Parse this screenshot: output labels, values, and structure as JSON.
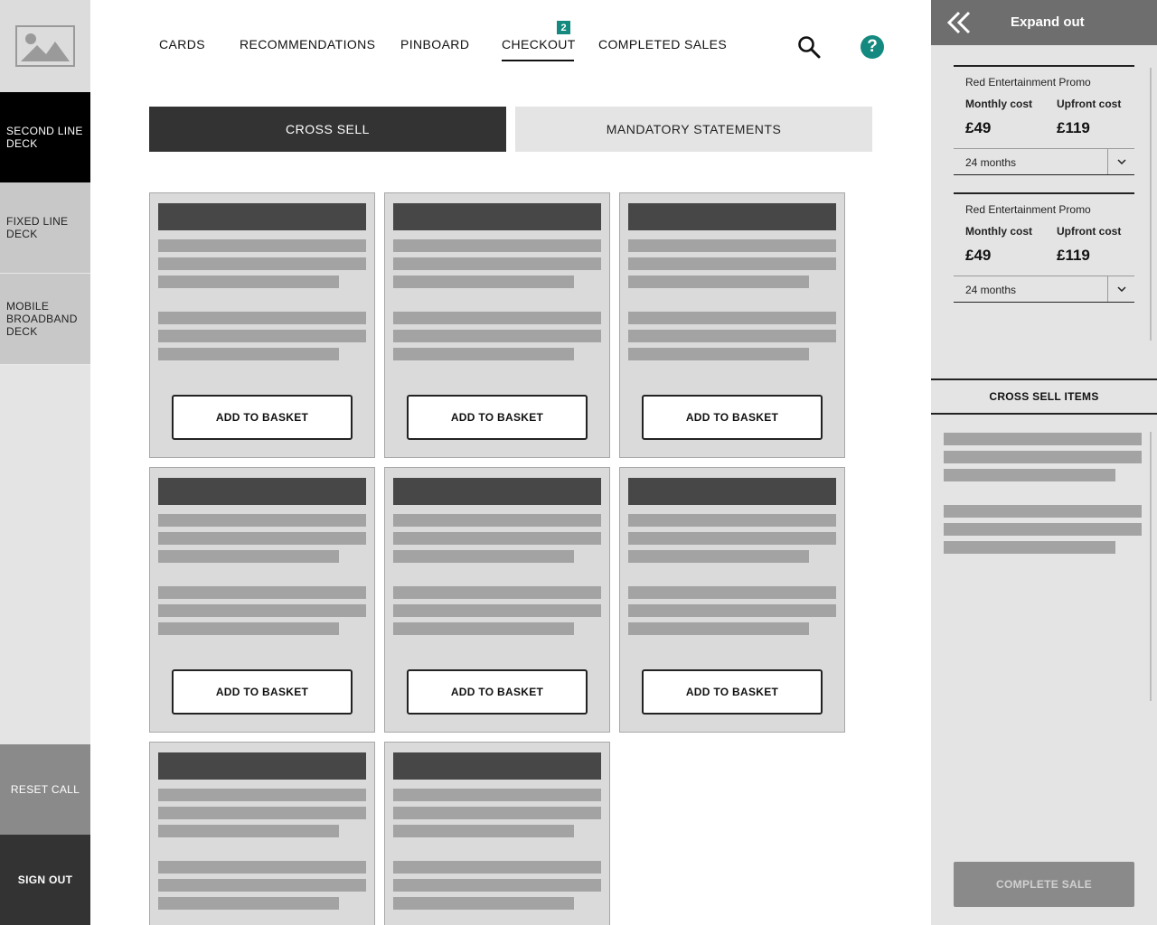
{
  "sidebar": {
    "logo_icon": "image-placeholder-icon",
    "items": [
      {
        "label": "SECOND LINE DECK",
        "active": true
      },
      {
        "label": "FIXED LINE DECK",
        "active": false
      },
      {
        "label": "MOBILE BROADBAND DECK",
        "active": false
      }
    ],
    "reset_label": "RESET CALL",
    "signout_label": "SIGN OUT"
  },
  "nav": {
    "items": [
      {
        "label": "CARDS"
      },
      {
        "label": "RECOMMENDATIONS"
      },
      {
        "label": "PINBOARD"
      },
      {
        "label": "CHECKOUT",
        "active": true,
        "badge": "2"
      },
      {
        "label": "COMPLETED SALES"
      }
    ],
    "search_icon": "search-icon",
    "help_icon": "help-icon",
    "help_glyph": "?",
    "accent_color": "#13897f"
  },
  "tabs": [
    {
      "label": "CROSS SELL",
      "active": true
    },
    {
      "label": "MANDATORY STATEMENTS",
      "active": false
    }
  ],
  "cards": {
    "button_label": "ADD TO BASKET",
    "count": 8
  },
  "right_panel": {
    "expand_label": "Expand out",
    "expand_icon": "double-chevron-left-icon",
    "offers": [
      {
        "name": "Red Entertainment Promo",
        "monthly_label": "Monthly cost",
        "monthly_value": "£49",
        "upfront_label": "Upfront cost",
        "upfront_value": "£119",
        "term": "24 months"
      },
      {
        "name": "Red Entertainment Promo",
        "monthly_label": "Monthly cost",
        "monthly_value": "£49",
        "upfront_label": "Upfront cost",
        "upfront_value": "£119",
        "term": "24 months"
      }
    ],
    "cross_sell_header": "CROSS SELL ITEMS",
    "complete_sale_label": "COMPLETE SALE"
  }
}
